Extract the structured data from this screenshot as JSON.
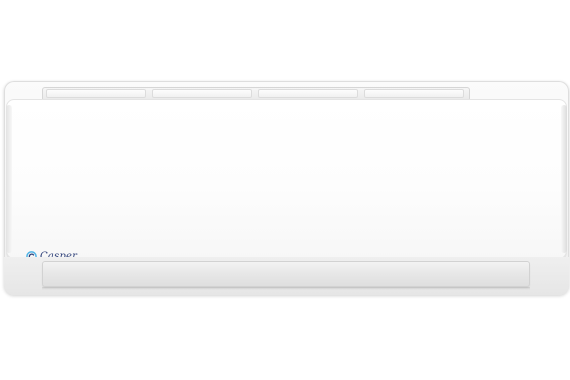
{
  "product": {
    "brand": "Casper",
    "logo_icon": "casper-c-logo-icon",
    "colors": {
      "body": "#f7f7f7",
      "logo": "#2d3f78",
      "logo_accent": "#4fb3e6"
    }
  }
}
